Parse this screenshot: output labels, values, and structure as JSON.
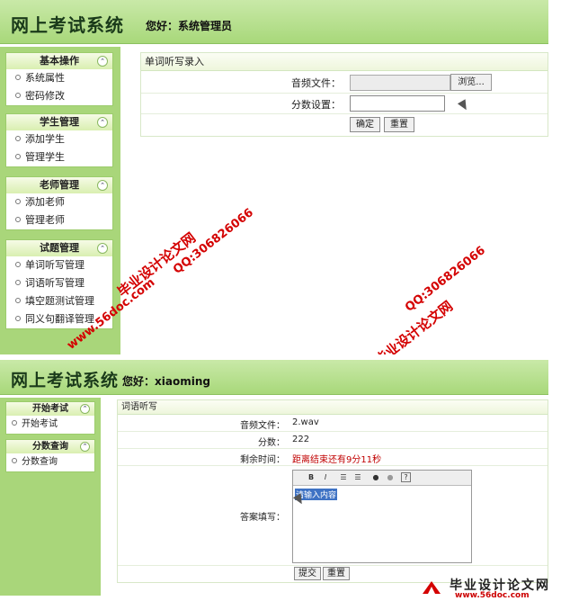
{
  "admin": {
    "app_title": "网上考试系统",
    "greeting": "您好：系统管理员",
    "sidebar": [
      {
        "title": "基本操作",
        "items": [
          "系统属性",
          "密码修改"
        ]
      },
      {
        "title": "学生管理",
        "items": [
          "添加学生",
          "管理学生"
        ]
      },
      {
        "title": "老师管理",
        "items": [
          "添加老师",
          "管理老师"
        ]
      },
      {
        "title": "试题管理",
        "items": [
          "单词听写管理",
          "词语听写管理",
          "填空题测试管理",
          "同义句翻译管理"
        ]
      }
    ],
    "panel_title": "单词听写录入",
    "audio_label": "音频文件：",
    "browse_label": "浏览...",
    "score_label": "分数设置：",
    "confirm_label": "确定",
    "reset_label": "重置"
  },
  "student": {
    "app_title": "网上考试系统",
    "greeting": "您好：xiaoming",
    "sidebar": [
      {
        "title": "开始考试",
        "items": [
          "开始考试"
        ]
      },
      {
        "title": "分数查询",
        "items": [
          "分数查询"
        ]
      }
    ],
    "panel_title": "词语听写",
    "audio_label": "音频文件：",
    "audio_value": "2.wav",
    "score_label": "分数：",
    "score_value": "222",
    "time_label": "剩余时间：",
    "time_value": "距离结束还有9分11秒",
    "answer_label": "答案填写：",
    "editor_placeholder": "请输入内容",
    "submit_label": "提交",
    "reset_label": "重置"
  },
  "watermarks": {
    "site_name": "毕业设计论文网",
    "qq": "QQ:306826066",
    "url": "www.56doc.com"
  },
  "logo": {
    "text": "毕业设计论文网",
    "url": "www.56doc.com"
  },
  "colors": {
    "sidebar_bg": "#a9d67a",
    "header_bg": "#b8df8e",
    "watermark": "#d40000",
    "highlight": "#3e72c4",
    "countdown": "#c00000"
  }
}
